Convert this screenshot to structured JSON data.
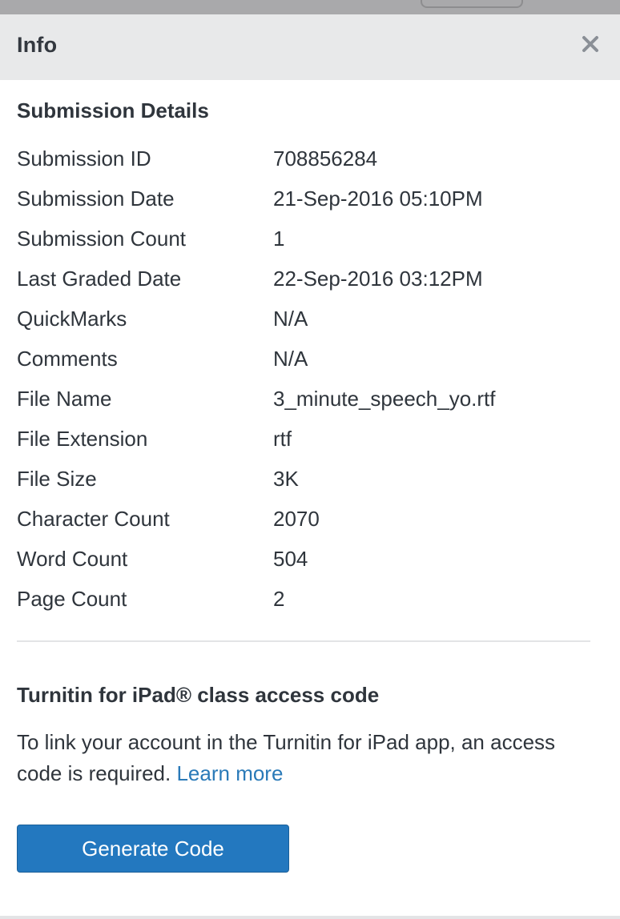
{
  "panel": {
    "title": "Info",
    "close_icon": "close-icon"
  },
  "submission_details": {
    "title": "Submission Details",
    "rows": [
      {
        "label": "Submission ID",
        "value": "708856284"
      },
      {
        "label": "Submission Date",
        "value": "21-Sep-2016 05:10PM"
      },
      {
        "label": "Submission Count",
        "value": "1"
      },
      {
        "label": "Last Graded Date",
        "value": "22-Sep-2016 03:12PM"
      },
      {
        "label": "QuickMarks",
        "value": "N/A"
      },
      {
        "label": "Comments",
        "value": "N/A"
      },
      {
        "label": "File Name",
        "value": "3_minute_speech_yo.rtf"
      },
      {
        "label": "File Extension",
        "value": "rtf"
      },
      {
        "label": "File Size",
        "value": "3K"
      },
      {
        "label": "Character Count",
        "value": "2070"
      },
      {
        "label": "Word Count",
        "value": "504"
      },
      {
        "label": "Page Count",
        "value": "2"
      }
    ]
  },
  "ipad_access": {
    "title": "Turnitin for iPad® class access code",
    "description": "To link your account in the Turnitin for iPad app, an access code is required.",
    "learn_more_label": "Learn more",
    "generate_button_label": "Generate Code"
  },
  "colors": {
    "header_bg": "#e8e9ea",
    "link": "#2a7ab8",
    "button_bg": "#2378bf"
  }
}
